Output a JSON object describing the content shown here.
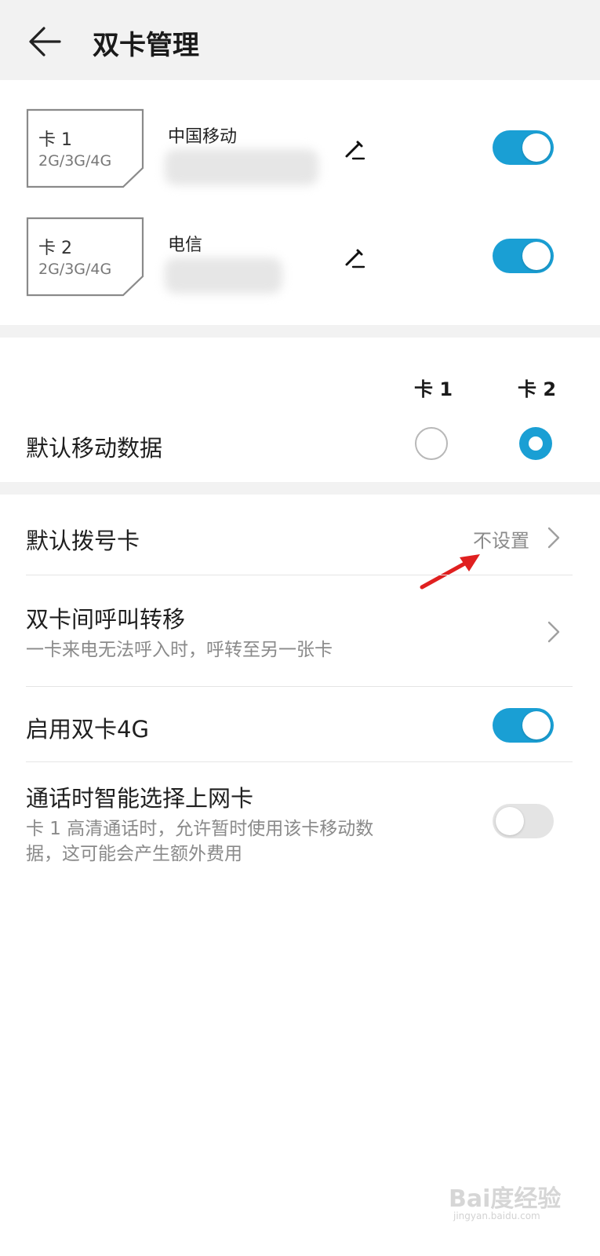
{
  "header": {
    "title": "双卡管理",
    "back_icon": "arrow-left-icon"
  },
  "sims": [
    {
      "label": "卡 1",
      "network": "2G/3G/4G",
      "carrier": "中国移动",
      "enabled": true
    },
    {
      "label": "卡 2",
      "network": "2G/3G/4G",
      "carrier": "电信",
      "enabled": true
    }
  ],
  "default_data": {
    "col1": "卡 1",
    "col2": "卡 2",
    "label": "默认移动数据",
    "selected": "卡 2"
  },
  "settings": {
    "default_dial": {
      "label": "默认拨号卡",
      "value": "不设置"
    },
    "call_forward": {
      "label": "双卡间呼叫转移",
      "sub": "一卡来电无法呼入时，呼转至另一张卡"
    },
    "dual_4g": {
      "label": "启用双卡4G",
      "enabled": true
    },
    "smart_data": {
      "label": "通话时智能选择上网卡",
      "sub_line1": "卡 1 高清通话时，允许暂时使用该卡移动数",
      "sub_line2": "据，这可能会产生额外费用",
      "enabled": false
    }
  },
  "watermark": {
    "text": "Bai度经验",
    "sub": "jingyan.baidu.com"
  },
  "colors": {
    "accent": "#1a9fd4",
    "annotation_arrow": "#e02020",
    "band": "#f2f2f2"
  }
}
